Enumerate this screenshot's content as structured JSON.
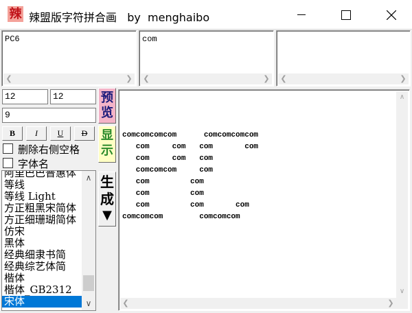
{
  "window": {
    "icon_char": "辣",
    "title": "辣盟版字符拼合画   by  menghaibo",
    "controls": [
      "minimize",
      "maximize",
      "close"
    ]
  },
  "top_boxes": [
    {
      "text": "PC6"
    },
    {
      "text": "com"
    },
    {
      "text": ""
    }
  ],
  "inputs": {
    "width": "12",
    "height": "12",
    "spacing": "9"
  },
  "format_buttons": [
    {
      "label": "B",
      "style": "bold"
    },
    {
      "label": "I",
      "style": "italic"
    },
    {
      "label": "U",
      "style": "underline"
    },
    {
      "label": "D",
      "style": "strike"
    }
  ],
  "checkboxes": [
    {
      "label": "删除右侧空格",
      "checked": false
    },
    {
      "label": "字体名",
      "checked": false
    }
  ],
  "side_buttons": {
    "preview": "预览",
    "display": "显示",
    "generate": "生成",
    "dropdown_arrow": "▼"
  },
  "font_list": {
    "items": [
      "阿里巴巴普惠体",
      "等线",
      "等线 Light",
      "方正粗黑宋简体",
      "方正细珊瑚简体",
      "仿宋",
      "黑体",
      "经典细隶书简",
      "经典综艺体简",
      "楷体",
      "楷体_GB2312",
      "宋体"
    ],
    "selected": "宋体"
  },
  "preview_text": "comcomcomcom      comcomcomcom\n   com     com   com       com\n   com     com   com\n   comcomcom     com\n   com         com\n   com         com\n   com         com       com\ncomcomcom        comcomcom",
  "colors": {
    "preview_bg": "#f4b4c8",
    "preview_fg": "#1a1a7a",
    "display_bg": "#ffffc4",
    "display_fg": "#2a8a2a",
    "selection": "#0078d7"
  }
}
